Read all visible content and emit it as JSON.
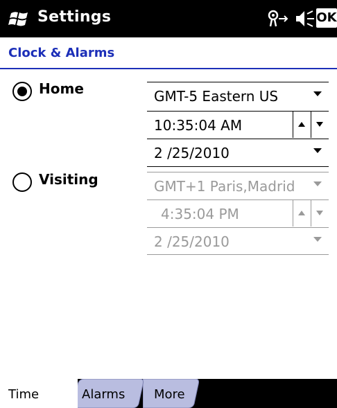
{
  "titlebar": {
    "title": "Settings",
    "ok_label": "OK"
  },
  "page": {
    "heading": "Clock & Alarms"
  },
  "home": {
    "label": "Home",
    "selected": true,
    "timezone": "GMT-5 Eastern US",
    "time": "10:35:04 AM",
    "date": "2 /25/2010"
  },
  "visiting": {
    "label": "Visiting",
    "selected": false,
    "timezone": "GMT+1 Paris,Madrid",
    "time": "4:35:04 PM",
    "date": "2 /25/2010"
  },
  "tabs": [
    {
      "label": "Time",
      "active": true
    },
    {
      "label": "Alarms",
      "active": false
    },
    {
      "label": "More",
      "active": false
    }
  ],
  "colors": {
    "heading_blue": "#1c2fb8",
    "tab_inactive": "#b9bde0",
    "disabled_text": "#9a9a9a"
  }
}
